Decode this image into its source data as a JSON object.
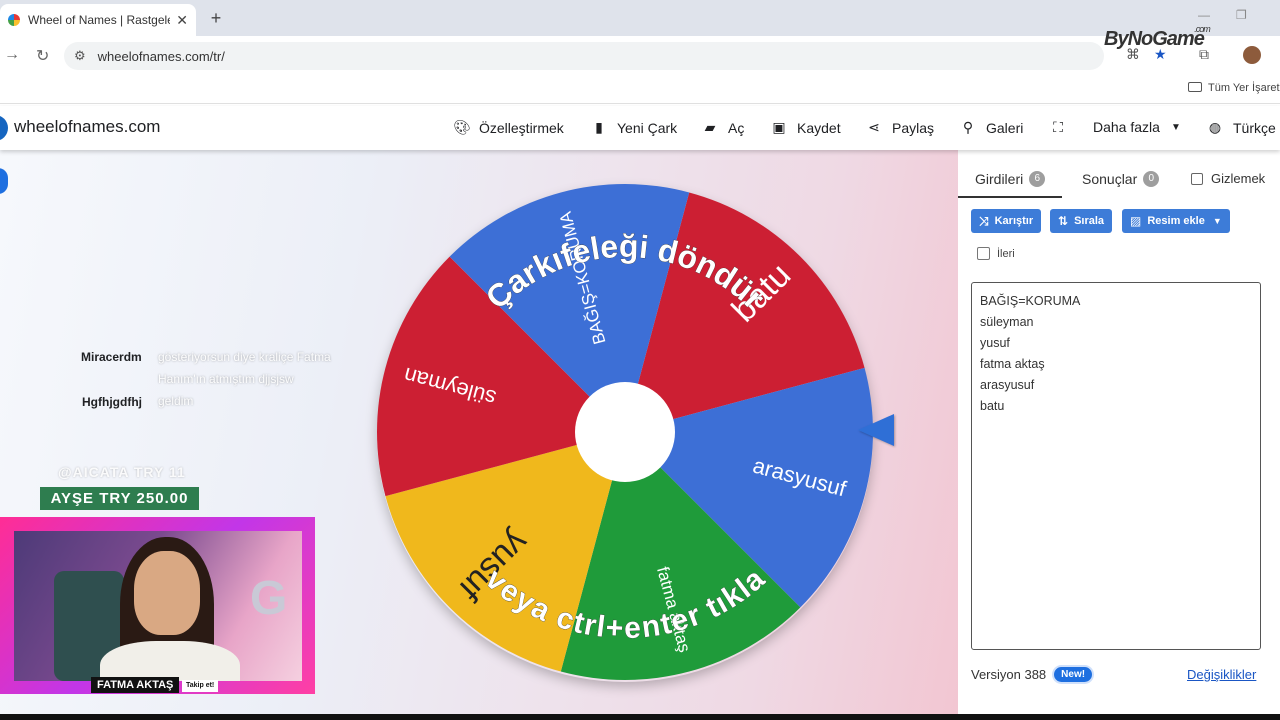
{
  "browser": {
    "tab_title": "Wheel of Names | Rastgele ad s",
    "tab_close": "✕",
    "new_tab": "+",
    "url": "wheelofnames.com/tr/",
    "bookmarks_all": "Tüm Yer İşaretle"
  },
  "watermark": {
    "brand": "ByNoGame",
    "suffix": ".com"
  },
  "site": {
    "name": "wheelofnames.com",
    "menu": [
      {
        "label": "Özelleştirmek",
        "icon": "palette-icon"
      },
      {
        "label": "Yeni Çark",
        "icon": "file-icon"
      },
      {
        "label": "Aç",
        "icon": "folder-open-icon"
      },
      {
        "label": "Kaydet",
        "icon": "save-icon"
      },
      {
        "label": "Paylaş",
        "icon": "share-icon"
      },
      {
        "label": "Galeri",
        "icon": "search-icon"
      },
      {
        "label": "",
        "icon": "fullscreen-icon"
      },
      {
        "label": "Daha fazla",
        "icon": "caret-down-icon"
      },
      {
        "label": "Türkçe",
        "icon": "globe-icon"
      }
    ]
  },
  "wheel": {
    "segments": [
      {
        "name": "batu",
        "color": "#cc1f33"
      },
      {
        "name": "arasyusuf",
        "color": "#3d6fd6"
      },
      {
        "name": "fatma aktaş",
        "color": "#1f9b3a"
      },
      {
        "name": "yusuf",
        "color": "#f0b81c"
      },
      {
        "name": "süleyman",
        "color": "#cc1f33"
      },
      {
        "name": "BAĞIŞ=KORUMA",
        "color": "#3d6fd6"
      }
    ],
    "prompt_top": "Çarkıfeleği döndür",
    "prompt_bottom": "veya ctrl+enter tıkla"
  },
  "overlay": {
    "chat": [
      {
        "user": "Miracerdm",
        "message": "gösteriyorsun diye kraliçe Fatma Hanım'ın atmıştım djjsjsw",
        "color": "#c2185b"
      },
      {
        "user": "Hgfhjgdfhj",
        "message": "geldim",
        "color": "#3f51b5"
      }
    ],
    "donation_faded": "@AICATA  TRY 11",
    "donation": "AYŞE  TRY 250.00",
    "streamer_name": "FATMA AKTAŞ",
    "follow_label": "Takip et!"
  },
  "panel": {
    "tabs": [
      {
        "label": "Girdileri",
        "count": "6"
      },
      {
        "label": "Sonuçlar",
        "count": "0"
      }
    ],
    "hide_label": "Gizlemek",
    "buttons": {
      "shuffle": "Karıştır",
      "sort": "Sırala",
      "add_image": "Resim ekle"
    },
    "advanced_label": "İleri",
    "entries": [
      "BAĞIŞ=KORUMA",
      "süleyman",
      "yusuf",
      "fatma aktaş",
      "arasyusuf",
      "batu"
    ],
    "version": "Versiyon 388",
    "new_badge": "New!",
    "changes": "Değişiklikler"
  }
}
